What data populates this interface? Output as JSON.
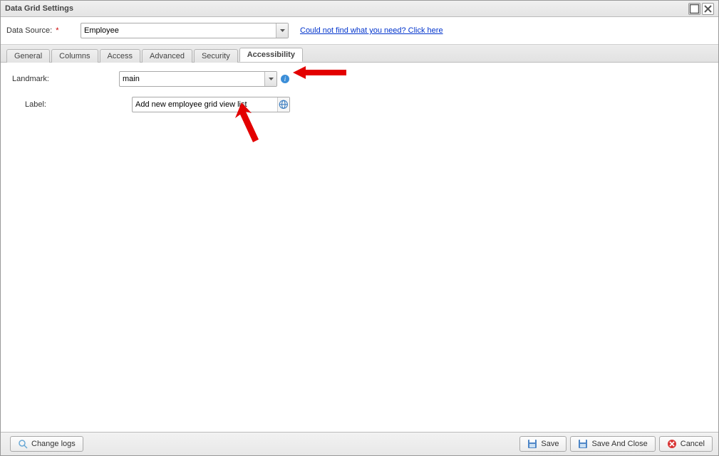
{
  "window": {
    "title": "Data Grid Settings"
  },
  "datasource": {
    "label": "Data Source:",
    "value": "Employee",
    "help_link": "Could not find what you need? Click here"
  },
  "tabs": {
    "general": "General",
    "columns": "Columns",
    "access": "Access",
    "advanced": "Advanced",
    "security": "Security",
    "accessibility": "Accessibility"
  },
  "form": {
    "landmark_label": "Landmark:",
    "landmark_value": "main",
    "label_label": "Label:",
    "label_value": "Add new employee grid view list"
  },
  "footer": {
    "change_logs": "Change logs",
    "save": "Save",
    "save_and_close": "Save And Close",
    "cancel": "Cancel"
  }
}
